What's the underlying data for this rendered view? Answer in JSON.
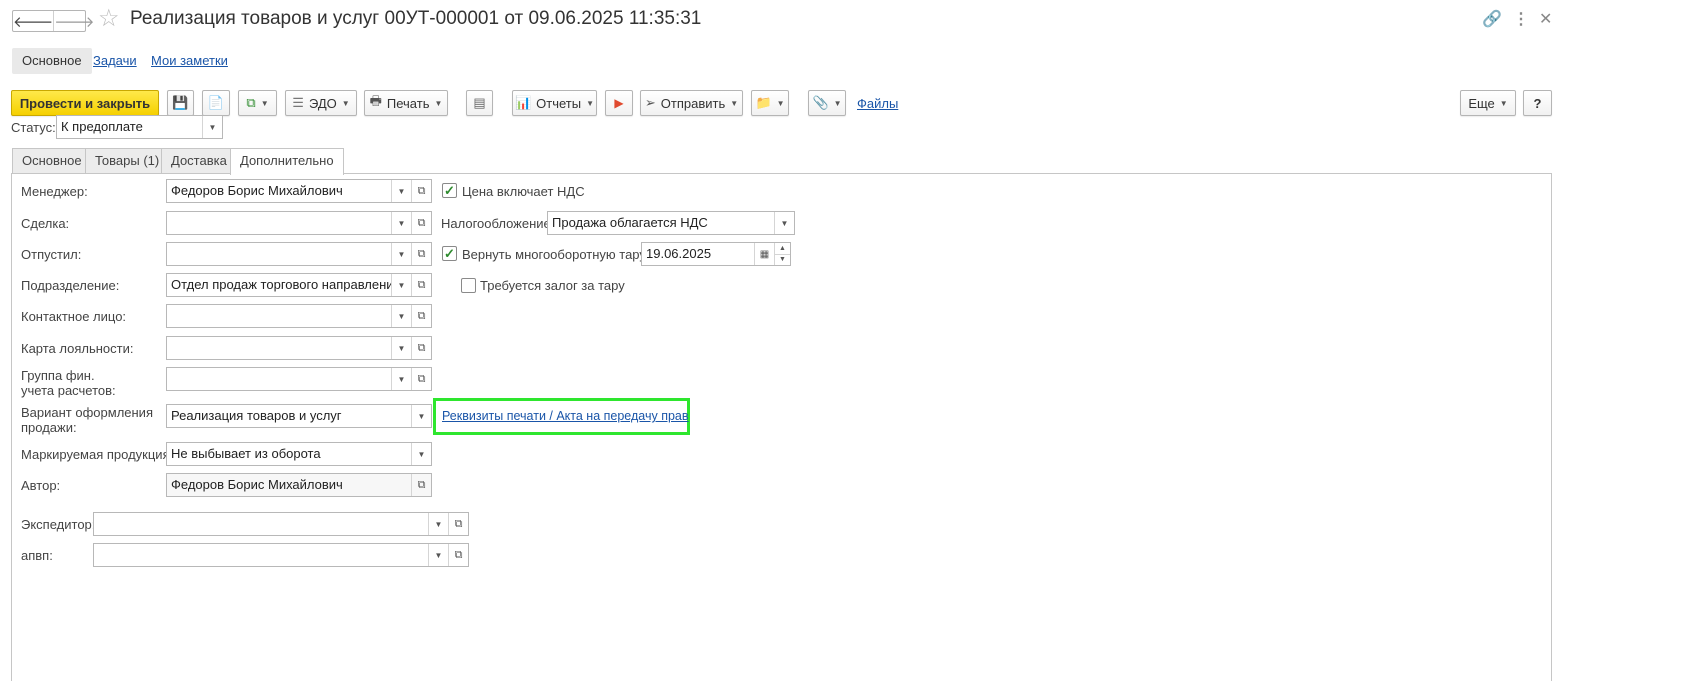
{
  "window": {
    "title": "Реализация товаров и услуг 00УТ-000001 от 09.06.2025 11:35:31",
    "icons": [
      "link-icon",
      "more-icon",
      "close-icon"
    ]
  },
  "top_tabs": {
    "main": "Основное",
    "tasks": "Задачи",
    "notes": "Мои заметки"
  },
  "toolbar": {
    "post_close": "Провести и закрыть",
    "edo": "ЭДО",
    "print": "Печать",
    "reports": "Отчеты",
    "send": "Отправить",
    "files": "Файлы",
    "more": "Еще",
    "help": "?"
  },
  "status": {
    "label": "Статус:",
    "value": "К предоплате"
  },
  "section_tabs": [
    "Основное",
    "Товары (1)",
    "Доставка",
    "Дополнительно"
  ],
  "form": {
    "manager_label": "Менеджер:",
    "manager_value": "Федоров Борис Михайлович",
    "deal_label": "Сделка:",
    "deal_value": "",
    "released_label": "Отпустил:",
    "released_value": "",
    "division_label": "Подразделение:",
    "division_value": "Отдел продаж торгового направления",
    "contact_label": "Контактное лицо:",
    "contact_value": "",
    "loyalty_label": "Карта лояльности:",
    "loyalty_value": "",
    "fin_group_label_1": "Группа фин.",
    "fin_group_label_2": "учета расчетов:",
    "fin_group_value": "",
    "sale_variant_label_1": "Вариант оформления",
    "sale_variant_label_2": "продажи:",
    "sale_variant_value": "Реализация товаров и услуг",
    "print_details_link": "Реквизиты печати / Акта на передачу прав",
    "marking_label": "Маркируемая продукция:",
    "marking_value": "Не выбывает из оборота",
    "author_label": "Автор:",
    "author_value": "Федоров Борис Михайлович",
    "forwarder_label": "Экспедитор:",
    "forwarder_value": "",
    "apvp_label": "апвп:",
    "apvp_value": "",
    "price_vat_label": "Цена включает НДС",
    "price_vat_checked": true,
    "taxation_label": "Налогообложение:",
    "taxation_value": "Продажа облагается НДС",
    "return_tare_label": "Вернуть многооборотную тару:",
    "return_tare_checked": true,
    "return_tare_date": "19.06.2025",
    "deposit_label": "Требуется залог за тару",
    "deposit_checked": false
  }
}
